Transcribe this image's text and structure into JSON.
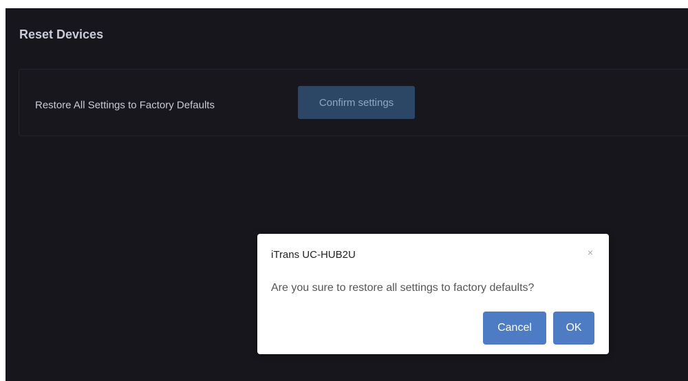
{
  "page": {
    "title": "Reset Devices"
  },
  "reset_section": {
    "label": "Restore All Settings to Factory Defaults",
    "confirm_button": "Confirm settings"
  },
  "dialog": {
    "title": "iTrans UC-HUB2U",
    "close_icon": "close-icon",
    "close_glyph": "×",
    "message": "Are you sure to restore all settings to factory defaults?",
    "cancel_label": "Cancel",
    "ok_label": "OK"
  },
  "colors": {
    "background": "#16161c",
    "confirm_button": "#2c4766",
    "dialog_button": "#4e7cc4"
  }
}
